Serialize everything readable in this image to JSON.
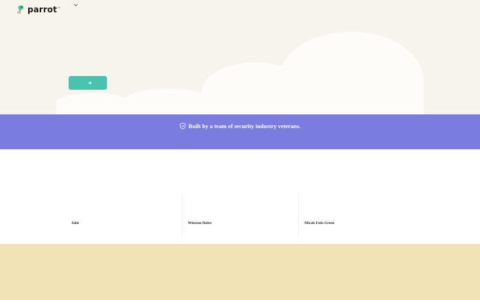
{
  "header": {
    "logo_text": "parrot",
    "logo_sup": "AI",
    "nav_dropdown_icon": "chevron-down-icon"
  },
  "hero": {
    "cta_icon": "arrow-right-icon",
    "background_color": "#f7f4ed",
    "cloud_color": "#fdfcf9",
    "cta_color": "#48c3ad"
  },
  "banner": {
    "text": "Built by a team of security industry veterans.",
    "icon": "shield-icon",
    "background_color": "#7b7ce0"
  },
  "testimonials": {
    "items": [
      {
        "name": "Julie"
      },
      {
        "name": "Winston Hofer"
      },
      {
        "name": "Micah Estis Green"
      }
    ]
  },
  "footer": {
    "background_color": "#f2e3b6"
  }
}
